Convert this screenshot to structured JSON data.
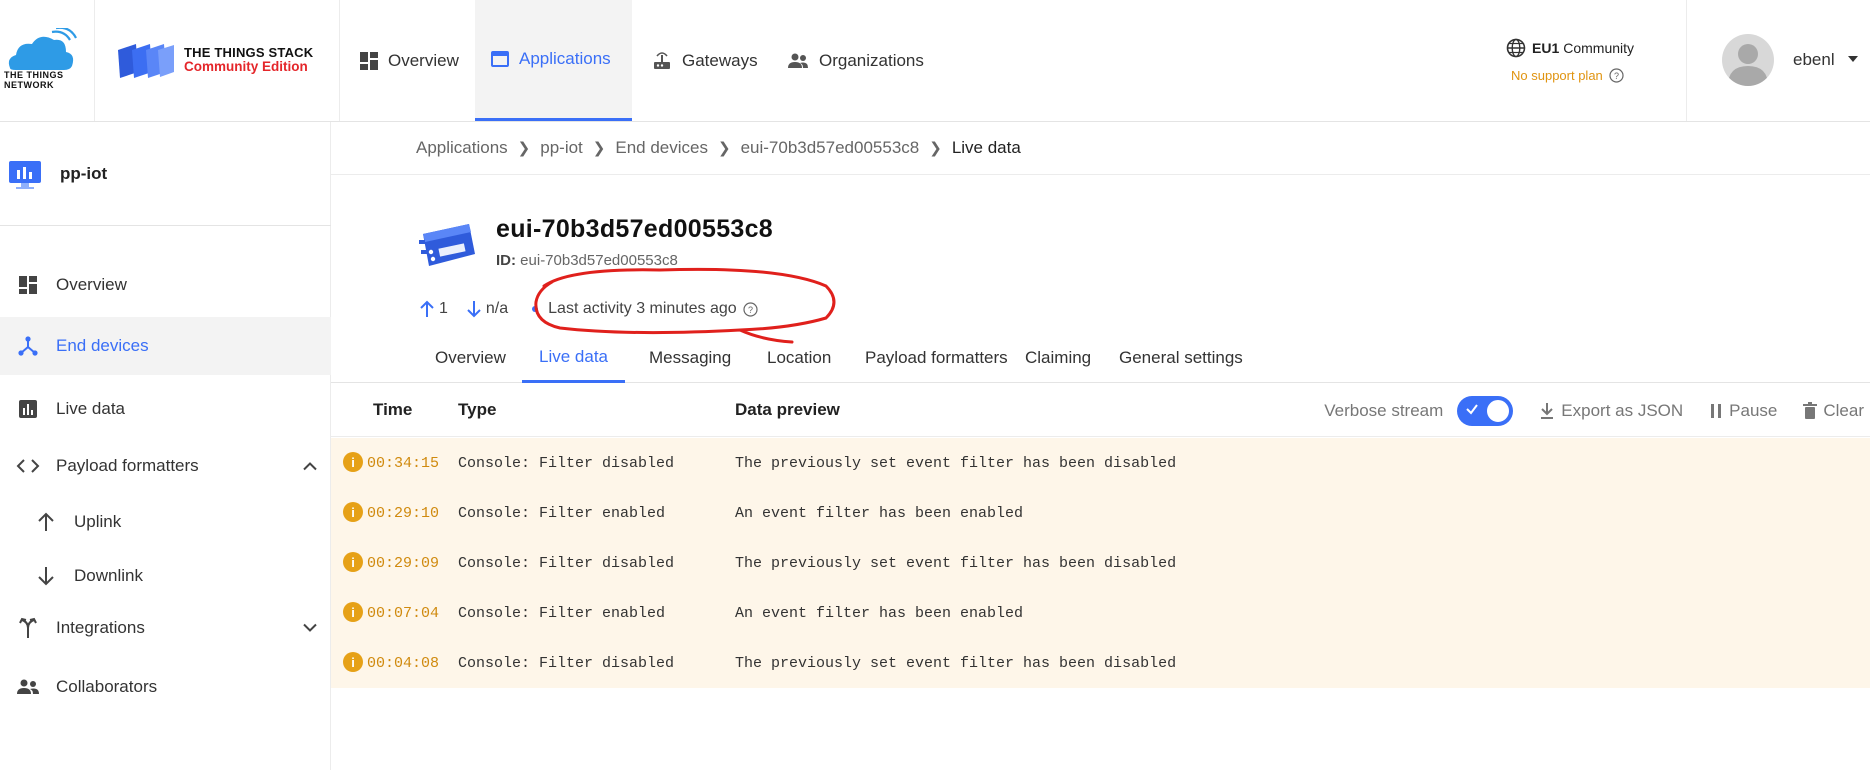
{
  "header": {
    "logo_text": "THE THINGS NETWORK",
    "product_name": "THE THINGS STACK",
    "product_edition": "Community Edition",
    "nav": [
      {
        "label": "Overview",
        "icon": "overview-icon",
        "active": false
      },
      {
        "label": "Applications",
        "icon": "applications-icon",
        "active": true
      },
      {
        "label": "Gateways",
        "icon": "gateway-icon",
        "active": false
      },
      {
        "label": "Organizations",
        "icon": "organizations-icon",
        "active": false
      }
    ],
    "cluster_region": "EU1",
    "cluster_name": "Community",
    "support_plan": "No support plan",
    "username": "ebenl"
  },
  "sidebar": {
    "app_name": "pp-iot",
    "items": [
      {
        "label": "Overview",
        "icon": "overview-icon"
      },
      {
        "label": "End devices",
        "icon": "end-devices-icon",
        "active": true
      },
      {
        "label": "Live data",
        "icon": "live-data-icon"
      },
      {
        "label": "Payload formatters",
        "icon": "code-icon",
        "expanded": true
      },
      {
        "label": "Uplink",
        "icon": "arrow-up-icon"
      },
      {
        "label": "Downlink",
        "icon": "arrow-down-icon"
      },
      {
        "label": "Integrations",
        "icon": "integrations-icon",
        "expanded": false
      },
      {
        "label": "Collaborators",
        "icon": "collaborators-icon"
      }
    ]
  },
  "breadcrumb": [
    "Applications",
    "pp-iot",
    "End devices",
    "eui-70b3d57ed00553c8",
    "Live data"
  ],
  "device": {
    "title": "eui-70b3d57ed00553c8",
    "id_label": "ID:",
    "id_value": "eui-70b3d57ed00553c8",
    "uplink_count": "1",
    "downlink_count": "n/a",
    "last_activity": "Last activity 3 minutes ago"
  },
  "tabs": [
    {
      "label": "Overview"
    },
    {
      "label": "Live data",
      "active": true
    },
    {
      "label": "Messaging"
    },
    {
      "label": "Location"
    },
    {
      "label": "Payload formatters"
    },
    {
      "label": "Claiming"
    },
    {
      "label": "General settings"
    }
  ],
  "events": {
    "columns": [
      "Time",
      "Type",
      "Data preview"
    ],
    "verbose_label": "Verbose stream",
    "verbose_on": true,
    "export_label": "Export as JSON",
    "pause_label": "Pause",
    "clear_label": "Clear",
    "rows": [
      {
        "time": "00:34:15",
        "type": "Console: Filter disabled",
        "preview": "The previously set event filter has been disabled"
      },
      {
        "time": "00:29:10",
        "type": "Console: Filter enabled",
        "preview": "An event filter has been enabled"
      },
      {
        "time": "00:29:09",
        "type": "Console: Filter disabled",
        "preview": "The previously set event filter has been disabled"
      },
      {
        "time": "00:07:04",
        "type": "Console: Filter enabled",
        "preview": "An event filter has been enabled"
      },
      {
        "time": "00:04:08",
        "type": "Console: Filter disabled",
        "preview": "The previously set event filter has been disabled"
      }
    ]
  },
  "colors": {
    "accent": "#3a6ff7",
    "brand_red": "#e4262a",
    "warning": "#e6a117",
    "row_bg": "#fef6e9",
    "annotation": "#e0201c"
  }
}
